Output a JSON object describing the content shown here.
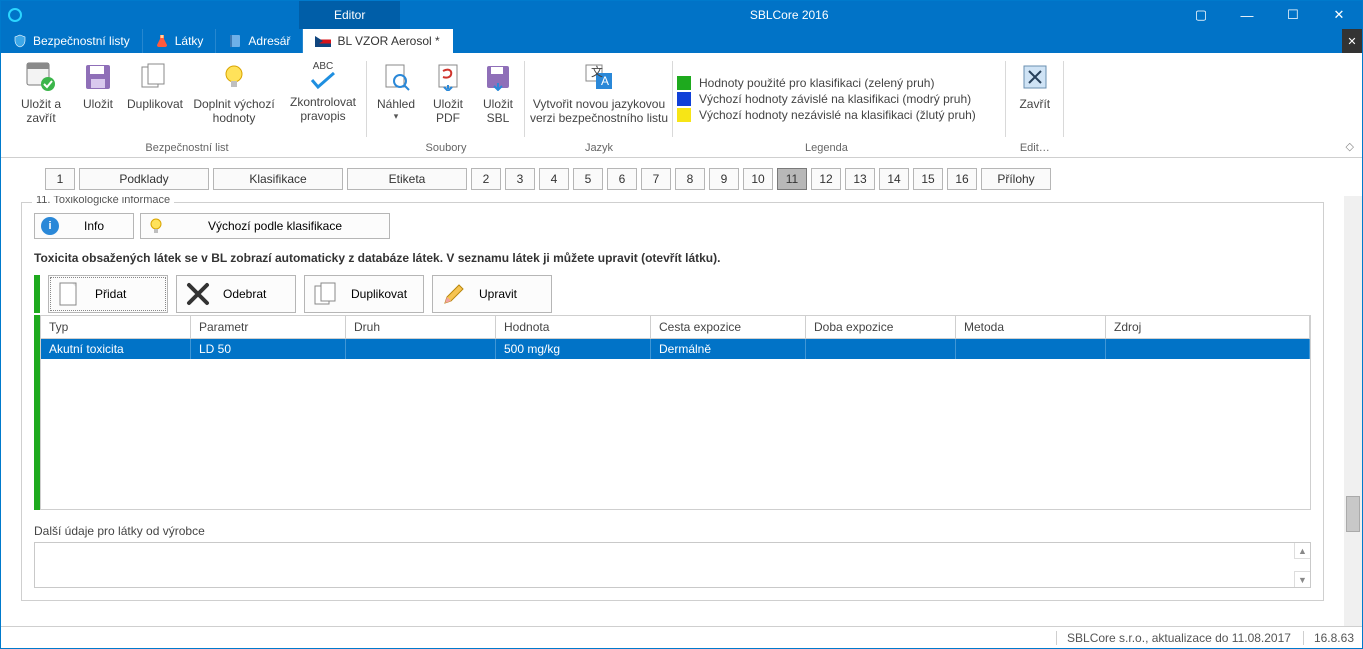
{
  "title": {
    "editor_tab": "Editor",
    "app": "SBLCore 2016"
  },
  "window_btns": {
    "opts": "▢",
    "min": "—",
    "max": "☐",
    "close": "✕"
  },
  "doctabs": {
    "items": [
      {
        "icon": "shield",
        "label": "Bezpečnostní listy"
      },
      {
        "icon": "flask",
        "label": "Látky"
      },
      {
        "icon": "book",
        "label": "Adresář"
      }
    ],
    "active": {
      "flag": "cz",
      "label": "BL VZOR Aerosol *"
    },
    "close": "✕"
  },
  "ribbon": {
    "g1": {
      "label": "Bezpečnostní list",
      "b1": "Uložit a zavřít",
      "b2": "Uložit",
      "b3": "Duplikovat",
      "b4": "Doplnit výchozí hodnoty",
      "b5": "Zkontrolovat pravopis",
      "b5_over": "ABC"
    },
    "g2": {
      "label": "Soubory",
      "b1": "Náhled",
      "b1_drop": "▾",
      "b2": "Uložit PDF",
      "b3": "Uložit SBL"
    },
    "g3": {
      "label": "Jazyk",
      "b1": "Vytvořit novou jazykovou verzi bezpečnostního listu"
    },
    "g4": {
      "label": "Legenda",
      "r1": "Hodnoty použité pro klasifikaci (zelený pruh)",
      "r2": "Výchozí hodnoty závislé na klasifikaci (modrý pruh)",
      "r3": "Výchozí hodnoty nezávislé na klasifikaci (žlutý pruh)",
      "c1": "#1eaa1e",
      "c2": "#1040d8",
      "c3": "#f7e516"
    },
    "g5": {
      "label": "Edit…",
      "b1": "Zavřít"
    }
  },
  "sections": {
    "items": [
      "1",
      "Podklady",
      "Klasifikace",
      "Etiketa",
      "2",
      "3",
      "4",
      "5",
      "6",
      "7",
      "8",
      "9",
      "10",
      "11",
      "12",
      "13",
      "14",
      "15",
      "16",
      "Přílohy"
    ],
    "active": "11"
  },
  "panel": {
    "legend": "11. Toxikologické informace",
    "info_btn": "Info",
    "defaults_btn": "Výchozí podle klasifikace",
    "hint": "Toxicita obsažených látek se v BL zobrazí automaticky z databáze látek. V seznamu látek ji můžete upravit (otevřít látku).",
    "tool_add": "Přidat",
    "tool_remove": "Odebrat",
    "tool_dup": "Duplikovat",
    "tool_edit": "Upravit",
    "table": {
      "headers": [
        "Typ",
        "Parametr",
        "Druh",
        "Hodnota",
        "Cesta expozice",
        "Doba expozice",
        "Metoda",
        "Zdroj"
      ],
      "rows": [
        {
          "Typ": "Akutní toxicita",
          "Parametr": "LD 50",
          "Druh": "",
          "Hodnota": "500 mg/kg",
          "Cesta expozice": "Dermálně",
          "Doba expozice": "",
          "Metoda": "",
          "Zdroj": ""
        }
      ]
    },
    "sub1": "Další údaje pro látky od výrobce"
  },
  "status": {
    "left": "SBLCore s.r.o., aktualizace do 11.08.2017",
    "right": "16.8.63"
  }
}
